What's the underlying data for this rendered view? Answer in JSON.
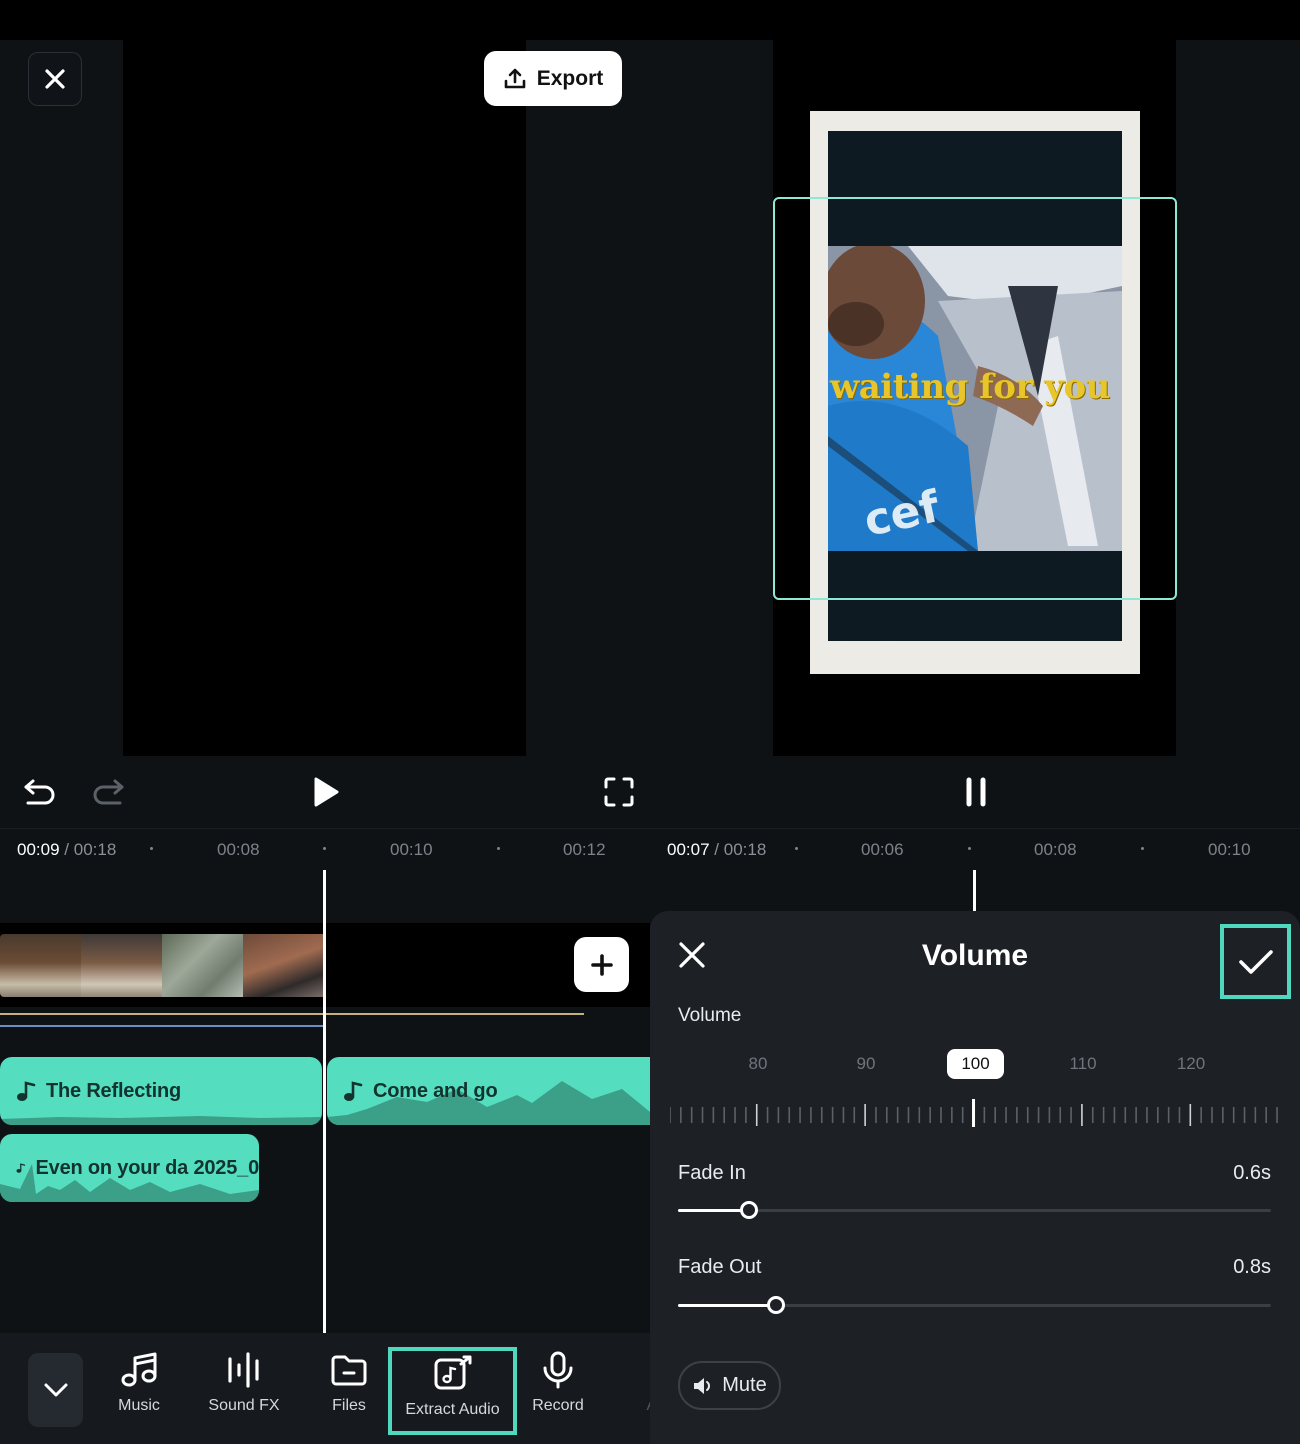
{
  "left": {
    "export_label": "Export",
    "current_time": "00:09",
    "separator": "/",
    "total_time": "00:18",
    "ruler_ticks": [
      "00:08",
      "00:10",
      "00:12"
    ],
    "clips": [
      {
        "title": "The Reflecting"
      },
      {
        "title": "Come and go"
      },
      {
        "title": "Even on your da 2025_0"
      }
    ],
    "tools": [
      {
        "label": "Music",
        "icon": "music-note-icon"
      },
      {
        "label": "Sound FX",
        "icon": "waveform-icon"
      },
      {
        "label": "Files",
        "icon": "folder-icon"
      },
      {
        "label": "Extract Audio",
        "icon": "extract-audio-icon"
      },
      {
        "label": "Record",
        "icon": "microphone-icon"
      },
      {
        "label": "AI",
        "icon": "ai-icon"
      }
    ]
  },
  "right": {
    "current_time": "00:07",
    "separator": "/",
    "total_time": "00:18",
    "ruler_ticks": [
      "00:06",
      "00:08",
      "00:10"
    ],
    "preview_overlay_text": "waiting for you",
    "volume_panel": {
      "title": "Volume",
      "volume_label": "Volume",
      "volume_value": 100,
      "volume_value_text": "100",
      "volume_scale_labels": [
        "80",
        "90",
        "110",
        "120"
      ],
      "fade_in_label": "Fade In",
      "fade_in_value": "0.6s",
      "fade_in_fraction": 0.12,
      "fade_out_label": "Fade Out",
      "fade_out_value": "0.8s",
      "fade_out_fraction": 0.165,
      "mute_label": "Mute"
    }
  },
  "colors": {
    "accent": "#55ddc0",
    "highlight": "#4fd8bd",
    "background": "#0f1215",
    "sheet": "#1d2126"
  }
}
